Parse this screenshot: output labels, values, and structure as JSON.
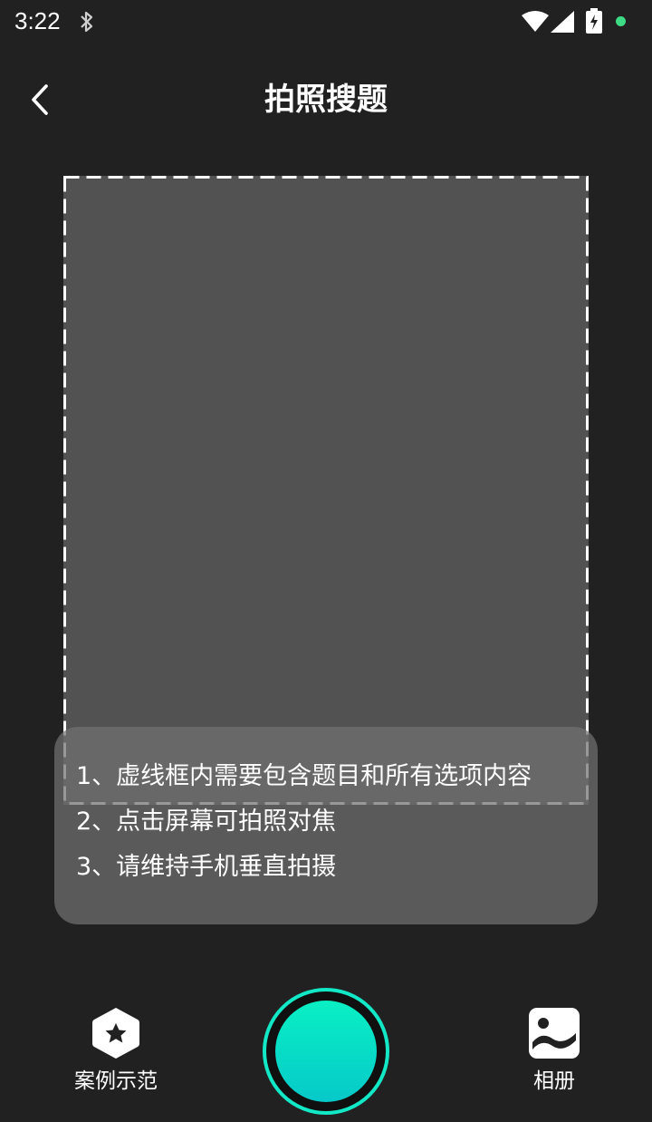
{
  "status_bar": {
    "time": "3:22",
    "icons": [
      "bluetooth-icon",
      "wifi-icon",
      "signal-icon",
      "battery-charging-icon",
      "notification-dot-icon"
    ],
    "dot_color": "#3ddc84"
  },
  "header": {
    "title": "拍照搜题",
    "back_icon": "chevron-left-icon"
  },
  "tips": [
    "1、虚线框内需要包含题目和所有选项内容",
    "2、点击屏幕可拍照对焦",
    "3、请维持手机垂直拍摄"
  ],
  "toolbar": {
    "example_label": "案例示范",
    "example_icon": "star-hexagon-icon",
    "album_label": "相册",
    "album_icon": "gallery-icon",
    "shutter_icon": "shutter-icon"
  },
  "colors": {
    "background": "#212121",
    "frame_fill": "#525252",
    "accent": "#12e8c6"
  }
}
